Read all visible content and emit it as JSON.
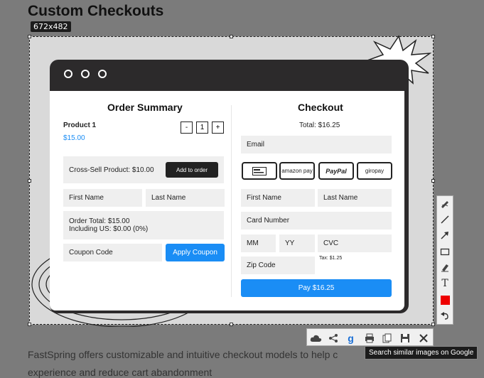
{
  "page": {
    "title": "Custom Checkouts",
    "dimensions_badge": "672x482",
    "body_text_line1": "FastSpring offers customizable and intuitive checkout models to help c",
    "body_text_line2": "experience and reduce cart abandonment"
  },
  "order_summary": {
    "heading": "Order Summary",
    "product_name": "Product 1",
    "product_price": "$15.00",
    "qty_minus": "-",
    "qty_value": "1",
    "qty_plus": "+",
    "cross_sell_label": "Cross-Sell Product: $10.00",
    "add_to_order": "Add to order",
    "first_name": "First Name",
    "last_name": "Last Name",
    "order_total": "Order Total: $15.00",
    "including_us": "Including US: $0.00 (0%)",
    "coupon_code": "Coupon Code",
    "apply_coupon": "Apply Coupon"
  },
  "checkout": {
    "heading": "Checkout",
    "total": "Total: $16.25",
    "email": "Email",
    "pay_methods": [
      "card",
      "amazon pay",
      "PayPal",
      "giropay"
    ],
    "first_name": "First Name",
    "last_name": "Last Name",
    "card_number": "Card Number",
    "mm": "MM",
    "yy": "YY",
    "cvc": "CVC",
    "tax": "Tax: $1.25",
    "zip": "Zip Code",
    "pay_button": "Pay $16.25"
  },
  "tooltip": "Search similar images on Google",
  "tool_icons": [
    "pencil-icon",
    "line-icon",
    "arrow-icon",
    "rectangle-icon",
    "marker-icon",
    "text-icon",
    "color-swatch-icon",
    "undo-icon"
  ],
  "action_icons": [
    "cloud-upload-icon",
    "share-icon",
    "google-search-icon",
    "print-icon",
    "copy-icon",
    "save-icon",
    "close-icon"
  ],
  "colors": {
    "accent": "#1a8df5",
    "swatch": "#ee0000",
    "window": "#2c2a2b"
  }
}
